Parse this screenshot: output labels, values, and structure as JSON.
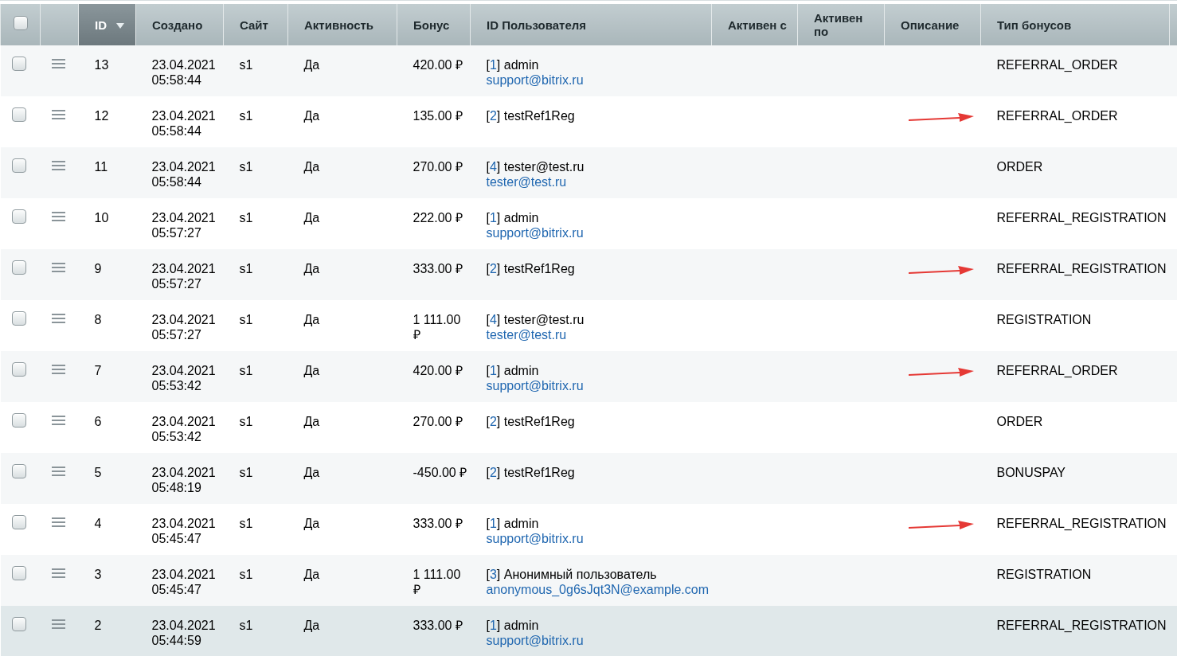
{
  "header_checkbox": {
    "checked": false
  },
  "columns": [
    {
      "kind": "blank"
    },
    {
      "kind": "text",
      "label": "ID",
      "sorted": true
    },
    {
      "kind": "text",
      "label": "Создано",
      "sorted": false
    },
    {
      "kind": "text",
      "label": "Сайт",
      "sorted": false
    },
    {
      "kind": "text",
      "label": "Активность",
      "sorted": false
    },
    {
      "kind": "text",
      "label": "Бонус",
      "sorted": false
    },
    {
      "kind": "text",
      "label": "ID Пользователя",
      "sorted": false
    },
    {
      "kind": "text",
      "label": "Активен с",
      "sorted": false
    },
    {
      "kind": "text",
      "label": "Активен по",
      "sorted": false
    },
    {
      "kind": "text",
      "label": "Описание",
      "sorted": false
    },
    {
      "kind": "text",
      "label": "Тип бонусов",
      "sorted": false
    }
  ],
  "id_brackets": {
    "open": "[",
    "close": "]"
  },
  "rows": [
    {
      "checked": false,
      "highlighted": false,
      "arrow": false,
      "id": "13",
      "created": "23.04.2021 05:58:44",
      "site": "s1",
      "active": "Да",
      "bonus": "420.00 ₽",
      "user_id": "1",
      "user_name": "admin",
      "email": "support@bitrix.ru",
      "type": "REFERRAL_ORDER"
    },
    {
      "checked": false,
      "highlighted": false,
      "arrow": true,
      "id": "12",
      "created": "23.04.2021 05:58:44",
      "site": "s1",
      "active": "Да",
      "bonus": "135.00 ₽",
      "user_id": "2",
      "user_name": "testRef1Reg",
      "type": "REFERRAL_ORDER"
    },
    {
      "checked": false,
      "highlighted": false,
      "arrow": false,
      "id": "11",
      "created": "23.04.2021 05:58:44",
      "site": "s1",
      "active": "Да",
      "bonus": "270.00 ₽",
      "user_id": "4",
      "user_name": "tester@test.ru",
      "email": "tester@test.ru",
      "type": "ORDER"
    },
    {
      "checked": false,
      "highlighted": false,
      "arrow": false,
      "id": "10",
      "created": "23.04.2021 05:57:27",
      "site": "s1",
      "active": "Да",
      "bonus": "222.00 ₽",
      "user_id": "1",
      "user_name": "admin",
      "email": "support@bitrix.ru",
      "type": "REFERRAL_REGISTRATION"
    },
    {
      "checked": false,
      "highlighted": false,
      "arrow": true,
      "id": "9",
      "created": "23.04.2021 05:57:27",
      "site": "s1",
      "active": "Да",
      "bonus": "333.00 ₽",
      "user_id": "2",
      "user_name": "testRef1Reg",
      "type": "REFERRAL_REGISTRATION"
    },
    {
      "checked": false,
      "highlighted": false,
      "arrow": false,
      "id": "8",
      "created": "23.04.2021 05:57:27",
      "site": "s1",
      "active": "Да",
      "bonus": "1 111.00 ₽",
      "user_id": "4",
      "user_name": "tester@test.ru",
      "email": "tester@test.ru",
      "type": "REGISTRATION"
    },
    {
      "checked": false,
      "highlighted": false,
      "arrow": true,
      "id": "7",
      "created": "23.04.2021 05:53:42",
      "site": "s1",
      "active": "Да",
      "bonus": "420.00 ₽",
      "user_id": "1",
      "user_name": "admin",
      "email": "support@bitrix.ru",
      "type": "REFERRAL_ORDER"
    },
    {
      "checked": false,
      "highlighted": false,
      "arrow": false,
      "id": "6",
      "created": "23.04.2021 05:53:42",
      "site": "s1",
      "active": "Да",
      "bonus": "270.00 ₽",
      "user_id": "2",
      "user_name": "testRef1Reg",
      "type": "ORDER"
    },
    {
      "checked": false,
      "highlighted": false,
      "arrow": false,
      "id": "5",
      "created": "23.04.2021 05:48:19",
      "site": "s1",
      "active": "Да",
      "bonus": "-450.00 ₽",
      "user_id": "2",
      "user_name": "testRef1Reg",
      "type": "BONUSPAY"
    },
    {
      "checked": false,
      "highlighted": false,
      "arrow": true,
      "id": "4",
      "created": "23.04.2021 05:45:47",
      "site": "s1",
      "active": "Да",
      "bonus": "333.00 ₽",
      "user_id": "1",
      "user_name": "admin",
      "email": "support@bitrix.ru",
      "type": "REFERRAL_REGISTRATION"
    },
    {
      "checked": false,
      "highlighted": false,
      "arrow": false,
      "id": "3",
      "created": "23.04.2021 05:45:47",
      "site": "s1",
      "active": "Да",
      "bonus": "1 111.00 ₽",
      "user_id": "3",
      "user_name": "Анонимный пользователь",
      "email": "anonymous_0g6sJqt3N@example.com",
      "type": "REGISTRATION"
    },
    {
      "checked": false,
      "highlighted": true,
      "arrow": false,
      "id": "2",
      "created": "23.04.2021 05:44:59",
      "site": "s1",
      "active": "Да",
      "bonus": "333.00 ₽",
      "user_id": "1",
      "user_name": "admin",
      "email": "support@bitrix.ru",
      "type": "REFERRAL_REGISTRATION"
    }
  ]
}
